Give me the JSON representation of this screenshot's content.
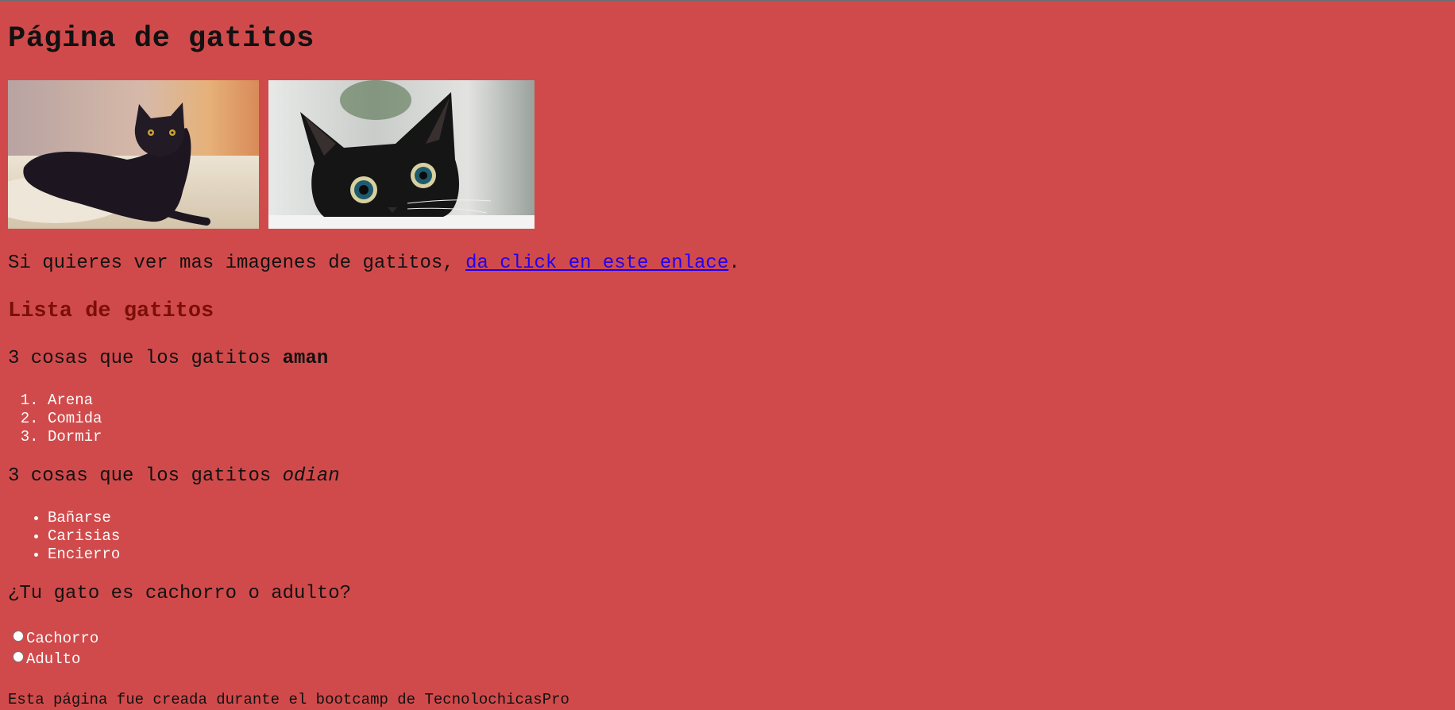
{
  "page": {
    "title": "Página de gatitos",
    "images": [
      {
        "name": "black-cat-lying-image"
      },
      {
        "name": "black-cat-peeking-image"
      }
    ],
    "link_sentence_prefix": "Si quieres ver mas imagenes de gatitos, ",
    "link_text": "da click en este enlace",
    "link_sentence_suffix": ".",
    "section_title": "Lista de gatitos",
    "love": {
      "prefix": "3 cosas que los gatitos ",
      "emphasis": "aman",
      "items": [
        "Arena",
        "Comida",
        "Dormir"
      ]
    },
    "hate": {
      "prefix": "3 cosas que los gatitos ",
      "emphasis": "odian",
      "items": [
        "Bañarse",
        "Carisias",
        "Encierro"
      ]
    },
    "question": "¿Tu gato es cachorro o adulto?",
    "options": [
      "Cachorro",
      "Adulto"
    ],
    "footer": "Esta página fue creada durante el bootcamp de TecnolochicasPro"
  },
  "colors": {
    "background": "#d14a4b",
    "heading_dark_red": "#7a0f0a",
    "list_text": "#fbfbfb",
    "link": "#2200ee"
  }
}
